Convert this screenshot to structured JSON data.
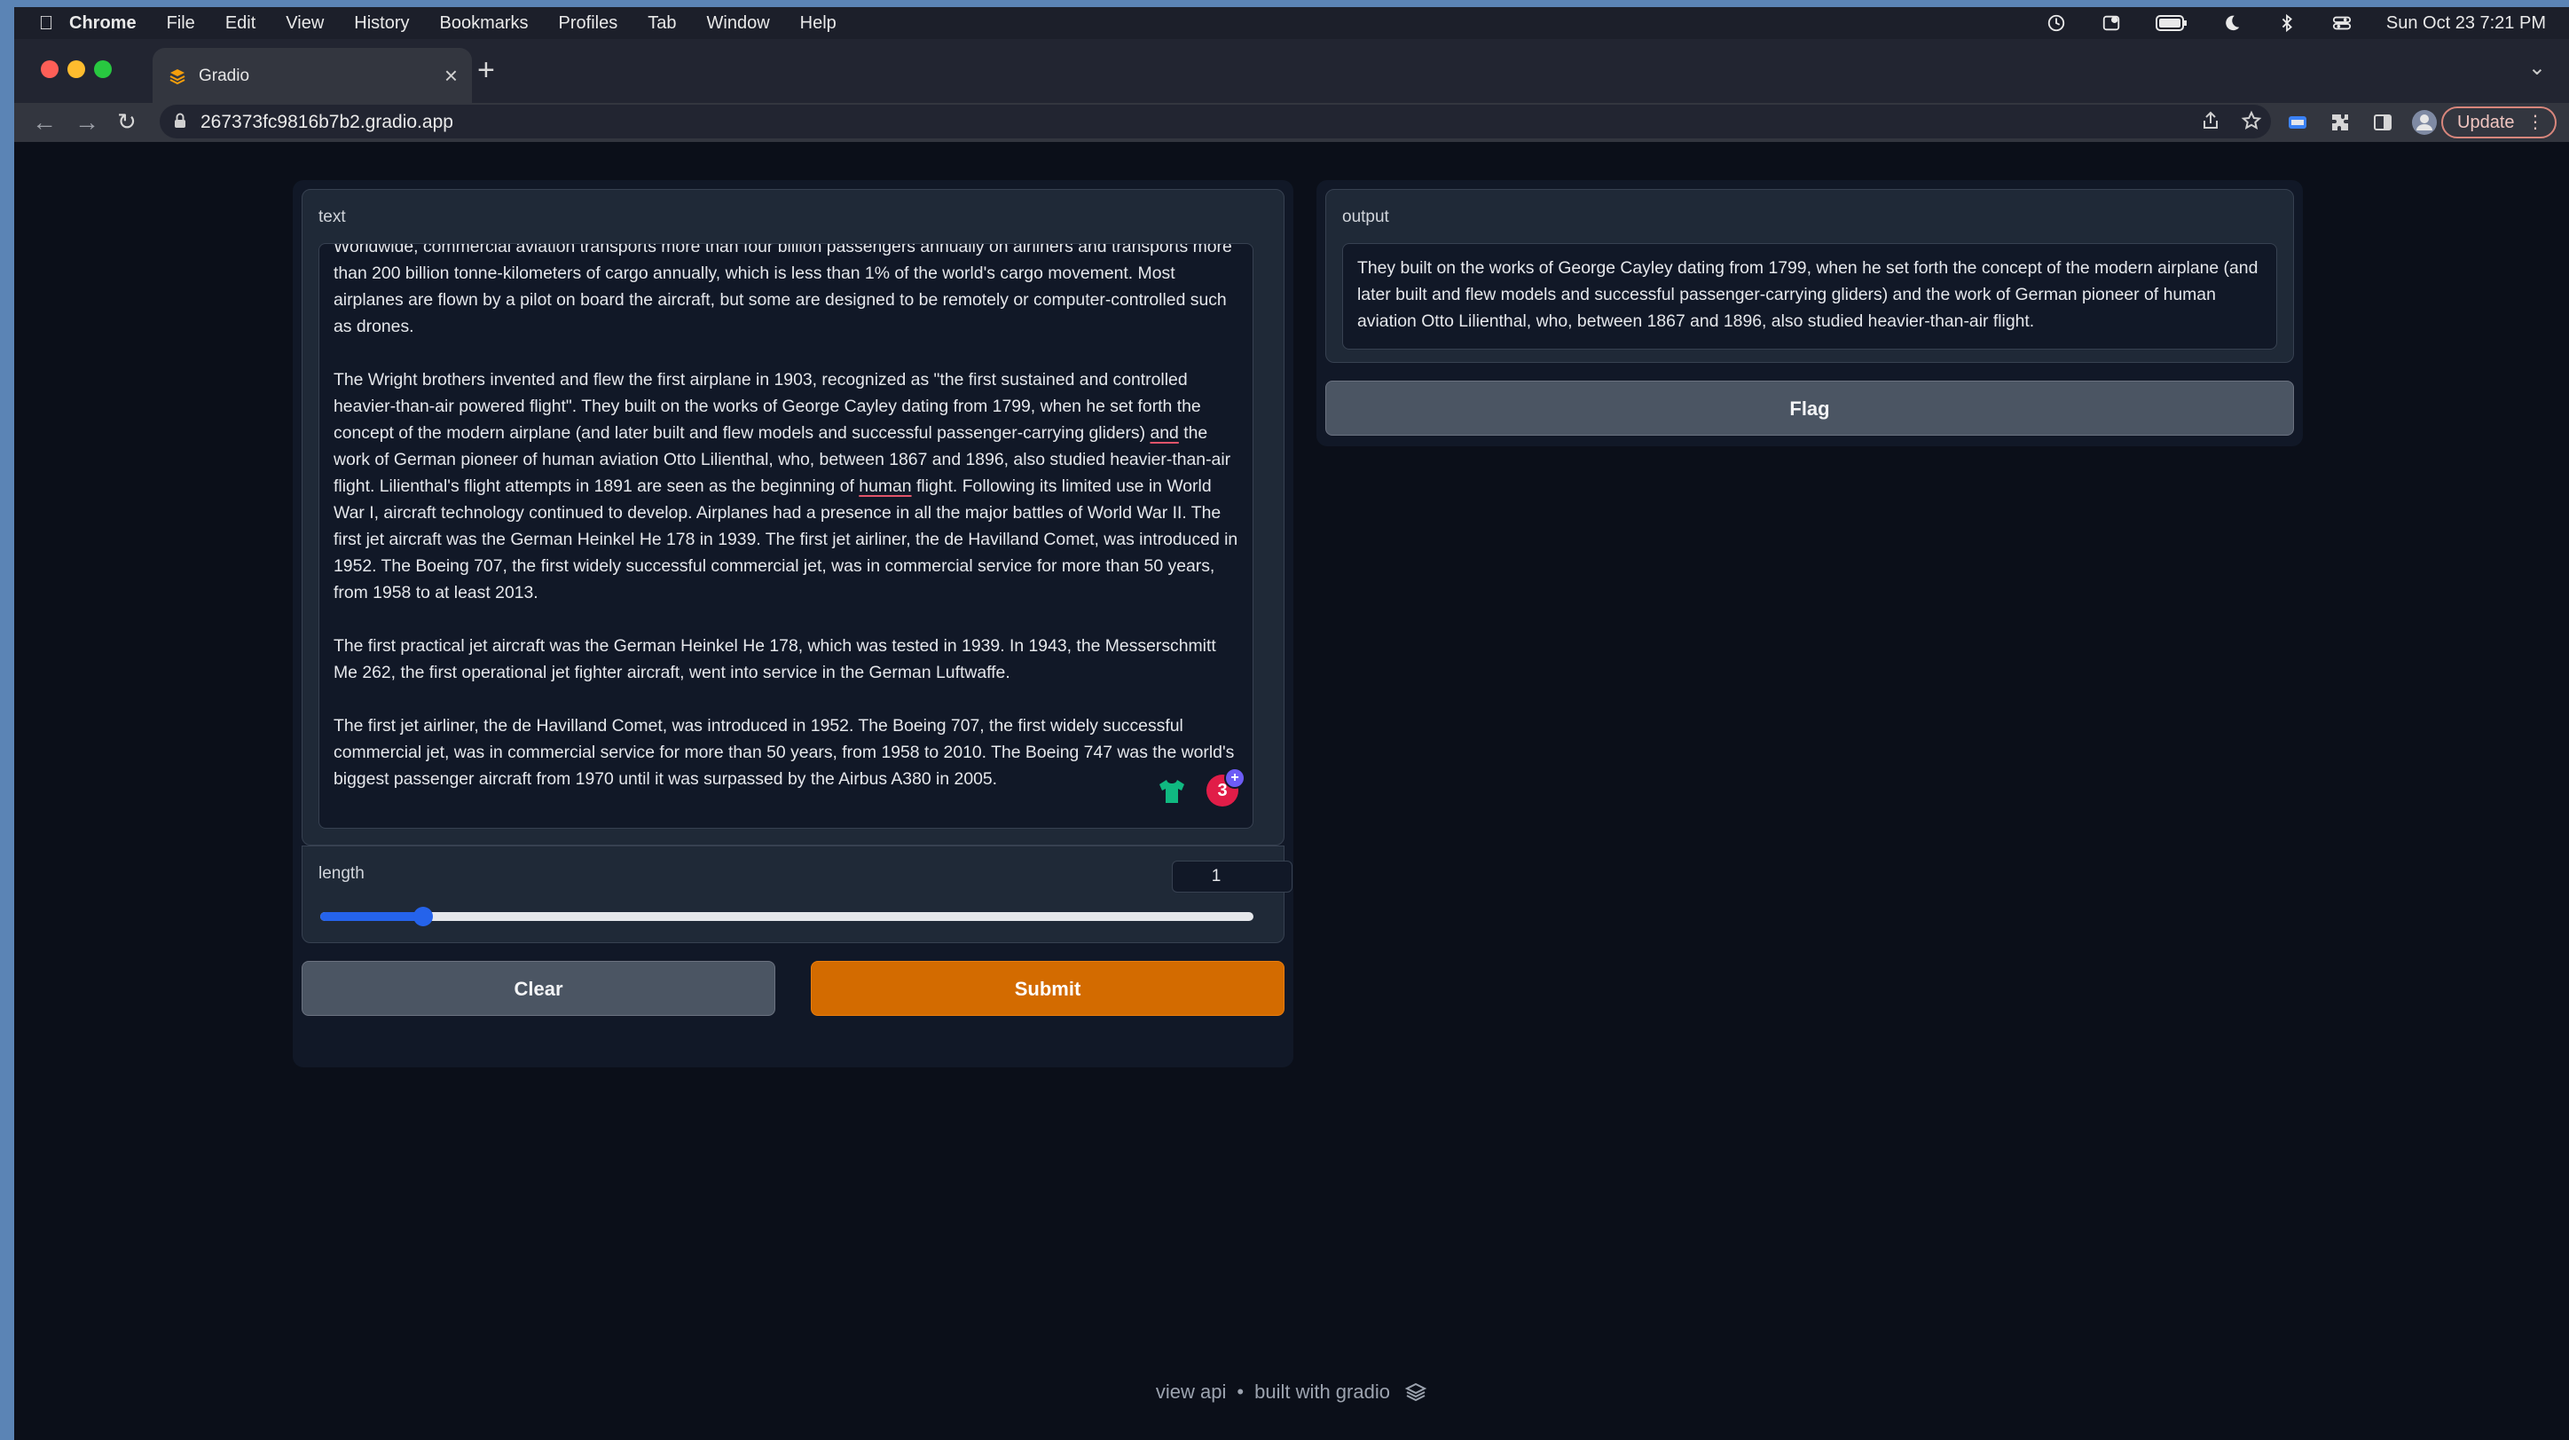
{
  "menubar": {
    "app": "Chrome",
    "items": [
      "File",
      "Edit",
      "View",
      "History",
      "Bookmarks",
      "Profiles",
      "Tab",
      "Window",
      "Help"
    ],
    "clock": "Sun Oct 23  7:21 PM"
  },
  "browser": {
    "tab_title": "Gradio",
    "url": "267373fc9816b7b2.gradio.app",
    "update_label": "Update"
  },
  "input": {
    "label": "text",
    "paragraphs": [
      "Worldwide, commercial aviation transports more than four billion passengers annually on airliners and transports more than 200 billion tonne-kilometers of cargo annually, which is less than 1% of the world's cargo movement. Most airplanes are flown by a pilot on board the aircraft, but some are designed to be remotely or computer-controlled such as drones.",
      "The Wright brothers invented and flew the first airplane in 1903, recognized as \"the first sustained and controlled heavier-than-air powered flight\". They built on the works of George Cayley dating from 1799, when he set forth the concept of the modern airplane (and later built and flew models and successful passenger-carrying gliders) and the work of German pioneer of human aviation Otto Lilienthal, who, between 1867 and 1896, also studied heavier-than-air flight. Lilienthal's flight attempts in 1891 are seen as the beginning of human flight. Following its limited use in World War I, aircraft technology continued to develop. Airplanes had a presence in all the major battles of World War II. The first jet aircraft was the German Heinkel He 178 in 1939. The first jet airliner, the de Havilland Comet, was introduced in 1952. The Boeing 707, the first widely successful commercial jet, was in commercial service for more than 50 years, from 1958 to at least 2013.",
      "The first practical jet aircraft was the German Heinkel He 178, which was tested in 1939. In 1943, the Messerschmitt Me 262, the first operational jet fighter aircraft, went into service in the German Luftwaffe.",
      "The first jet airliner, the de Havilland Comet, was introduced in 1952. The Boeing 707, the first widely successful commercial jet, was in commercial service for more than 50 years, from 1958 to 2010. The Boeing 747 was the world's biggest passenger aircraft from 1970 until it was surpassed by the Airbus A380 in 2005."
    ],
    "badge_count": "3"
  },
  "length": {
    "label": "length",
    "value": "1",
    "slider_fraction": 0.11
  },
  "buttons": {
    "clear": "Clear",
    "submit": "Submit",
    "flag": "Flag"
  },
  "output": {
    "label": "output",
    "text": "They built on the works of George Cayley dating from 1799, when he set forth the concept of the modern airplane (and later built and flew models and successful passenger-carrying gliders) and the work of German pioneer of human aviation Otto Lilienthal, who, between 1867 and 1896, also studied heavier-than-air flight."
  },
  "footer": {
    "view_api": "view api",
    "separator": "•",
    "built_with": "built with gradio"
  },
  "colors": {
    "submit": "#d36b00",
    "slider": "#2563eb",
    "badge": "#e11d48"
  }
}
